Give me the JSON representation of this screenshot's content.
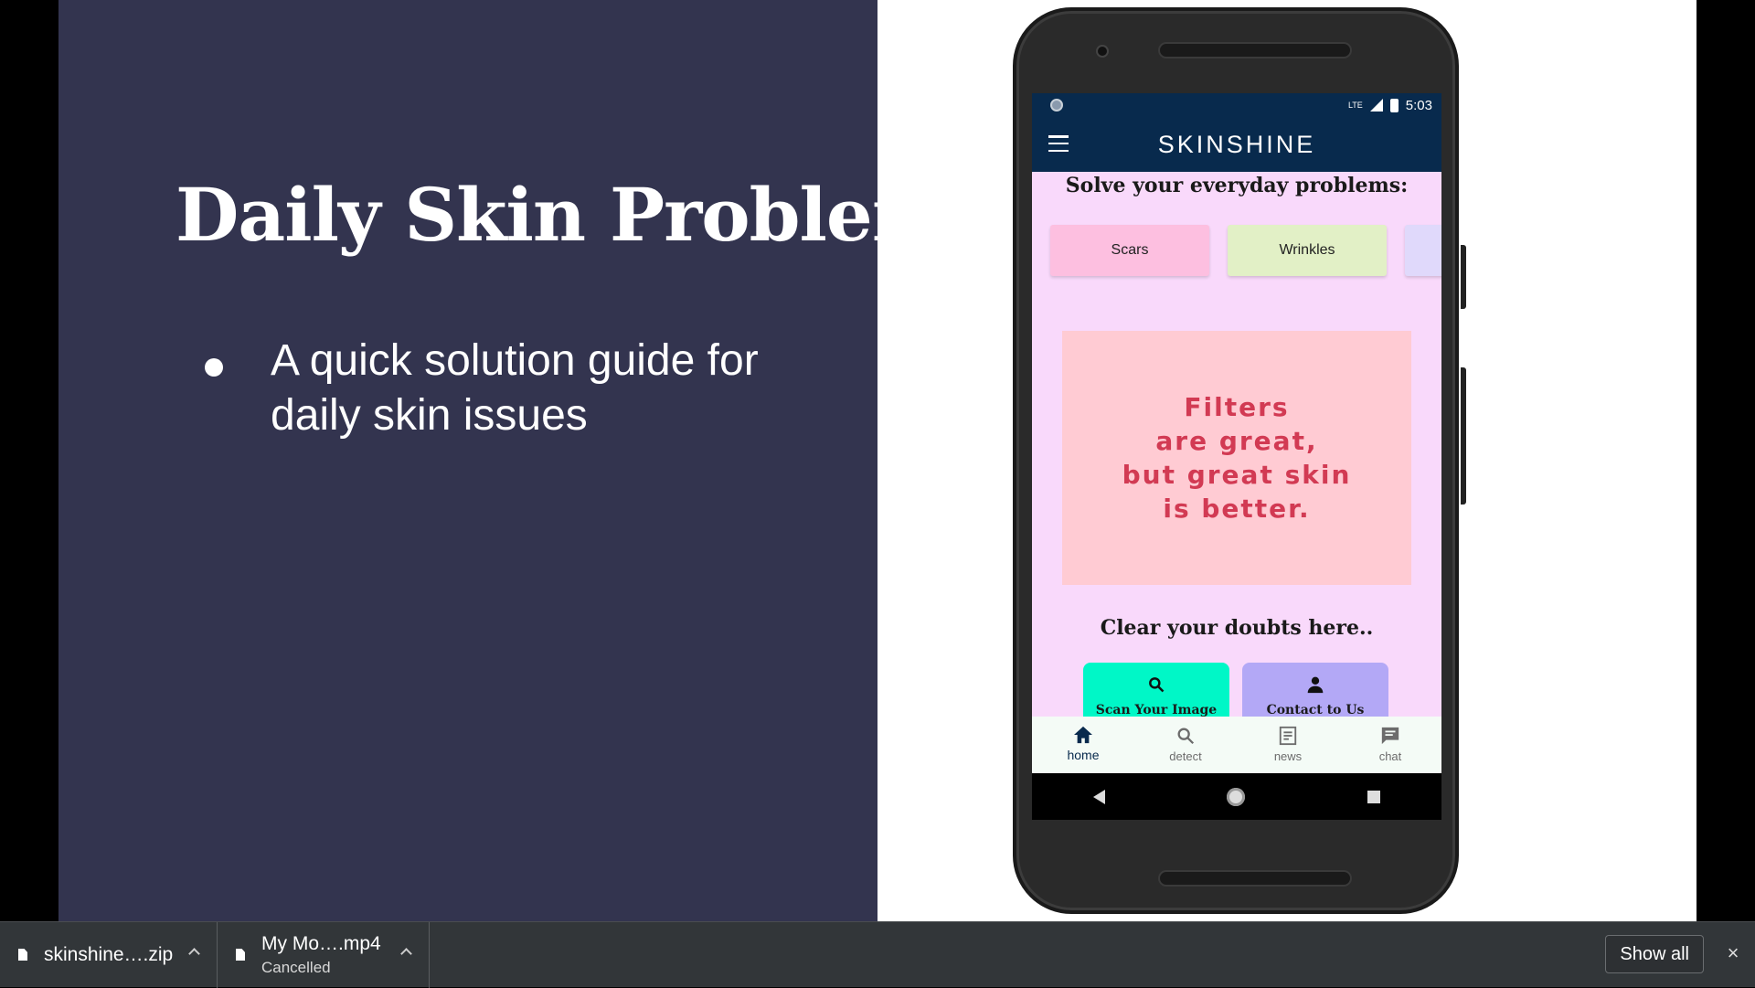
{
  "slide": {
    "title": "Daily Skin Problems",
    "bullet": "A quick solution guide for daily skin issues"
  },
  "phone": {
    "status_time": "5:03",
    "status_network": "LTE",
    "app_title": "SKINSHINE",
    "problems_heading": "Solve your everyday problems:",
    "chips": [
      "Scars",
      "Wrinkles"
    ],
    "quote": "Filters\nare great,\nbut great skin\nis better.",
    "doubts_heading": "Clear your doubts here..",
    "scan_label": "Scan Your Image",
    "contact_label": "Contact to Us",
    "nav": [
      {
        "label": "home",
        "icon": "home-icon",
        "active": true
      },
      {
        "label": "detect",
        "icon": "search-icon"
      },
      {
        "label": "news",
        "icon": "news-icon"
      },
      {
        "label": "chat",
        "icon": "chat-icon"
      }
    ],
    "colors": {
      "app_bar": "#082a4d",
      "screen_bg": "#f9d9fb",
      "chip_scars": "#fdbfe0",
      "chip_wrinkles": "#e2f0c6",
      "quote_bg": "#ffcbd3",
      "quote_text": "#d23a53",
      "scan_btn": "#00f7c7",
      "contact_btn": "#b3a8f6"
    }
  },
  "downloads": {
    "items": [
      {
        "name": "skinshine….zip",
        "status": ""
      },
      {
        "name": "My Mo….mp4",
        "status": "Cancelled"
      }
    ],
    "show_all": "Show all",
    "close": "×"
  }
}
